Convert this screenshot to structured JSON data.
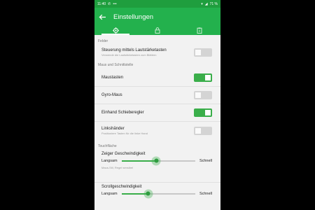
{
  "status": {
    "time": "11:40",
    "battery": "71 %"
  },
  "appbar": {
    "title": "Einstellungen"
  },
  "tabs": [
    {
      "icon": "gear-icon",
      "active": true
    },
    {
      "icon": "lock-icon",
      "active": false
    },
    {
      "icon": "clipboard-icon",
      "active": false
    }
  ],
  "sections": {
    "felder": "Felder",
    "maus": "Maus und Schnittstelle",
    "touch": "Touchfläche"
  },
  "settings": {
    "volume": {
      "title": "Steuerung mittels Lautstärketasten",
      "sub": "Verwende die Lautstärketasten zum Blättern",
      "on": false
    },
    "mousekeys": {
      "title": "Maustasten",
      "on": true
    },
    "gyro": {
      "title": "Gyro-Maus",
      "on": false
    },
    "onehand": {
      "title": "Einhand Schieberegler",
      "on": true
    },
    "lefthand": {
      "title": "Linkshänder",
      "sub": "Positioniere Tasten für die linke Hand",
      "on": false
    }
  },
  "sliders": {
    "pointer": {
      "title": "Zeiger Geschwindigkeit",
      "min": "Langsam",
      "max": "Schnell",
      "value": 0.47,
      "sub": "Maus-Stil, Regel sensibel"
    },
    "scroll": {
      "title": "Scrollgeschwindigkeit",
      "min": "Langsam",
      "max": "Schnell",
      "value": 0.36
    }
  },
  "colors": {
    "appbar": "#23b14d",
    "statusbar": "#1f9e3e",
    "accent": "#3aae4a"
  }
}
